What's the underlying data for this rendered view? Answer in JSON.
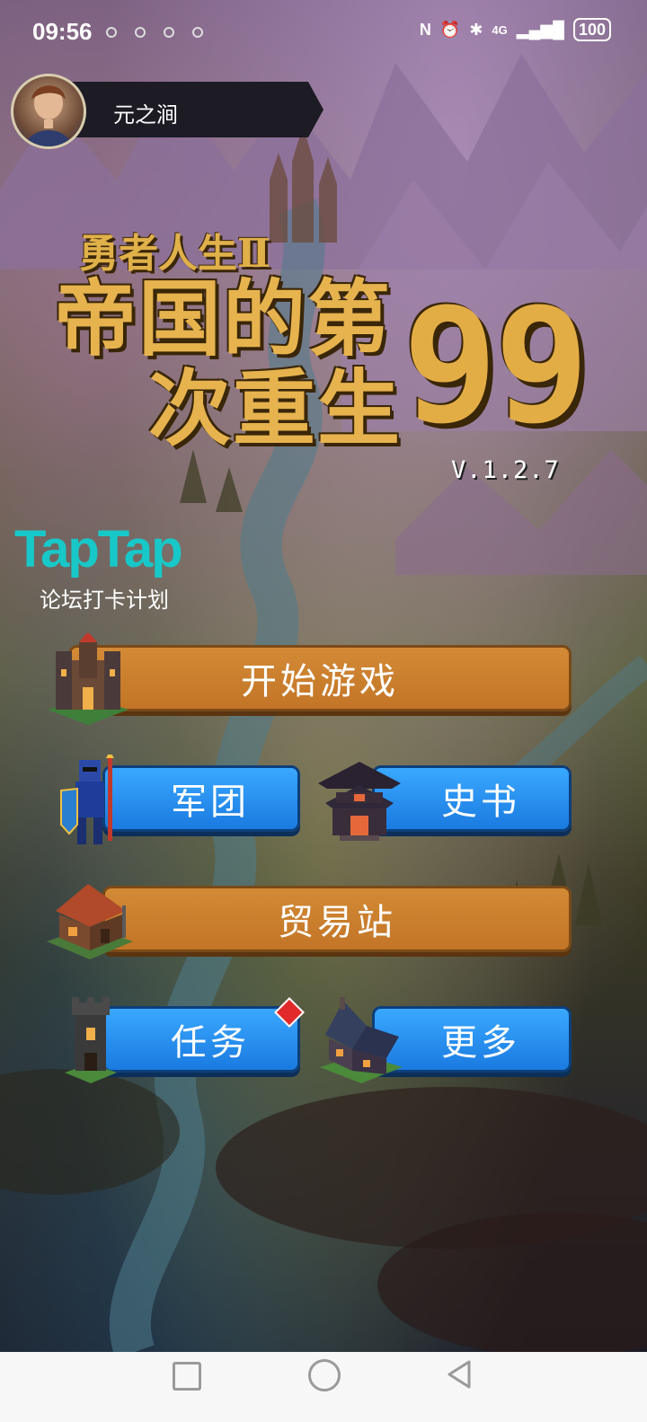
{
  "status_bar": {
    "time": "09:56",
    "network": "4G",
    "battery": "100"
  },
  "profile": {
    "name": "元之涧"
  },
  "title": {
    "series": "勇者人生Ⅱ",
    "line1": "帝国的第",
    "line2": "次重生",
    "number": "99",
    "version": "V.1.2.7"
  },
  "taptap": {
    "logo": "TapTap",
    "subtitle": "论坛打卡计划"
  },
  "menu": {
    "start_game": "开始游戏",
    "legion": "军团",
    "history_book": "史书",
    "trading_post": "贸易站",
    "missions": "任务",
    "more": "更多"
  },
  "colors": {
    "orange_button": "#c27526",
    "blue_button": "#1a7ae0",
    "title_gold": "#e6b34e",
    "taptap_teal": "#18c8c8"
  }
}
